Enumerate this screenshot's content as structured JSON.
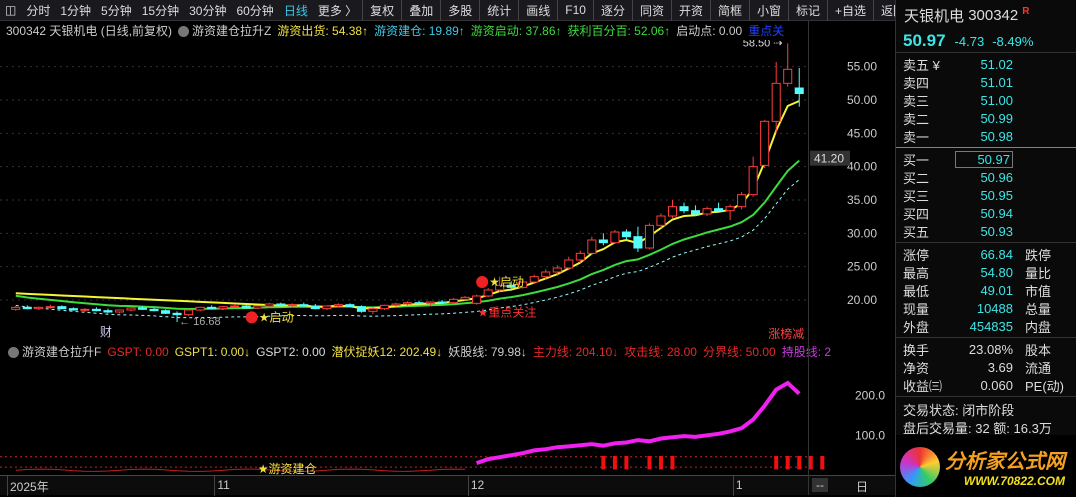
{
  "toolbar": {
    "period_items": [
      "分时",
      "1分钟",
      "5分钟",
      "15分钟",
      "30分钟",
      "60分钟",
      "日线",
      "更多 〉"
    ],
    "active": "日线",
    "buttons": [
      "复权",
      "叠加",
      "多股",
      "统计",
      "画线",
      "F10",
      "逐分",
      "同资",
      "开资",
      "简框",
      "小窗",
      "标记",
      "+自选",
      "返回"
    ]
  },
  "infobar": {
    "title": "300342 天银机电 (日线,前复权)",
    "indicator": "游资建仓拉升Z",
    "items": [
      {
        "label": "游资出货: 54.38↑",
        "color": "#f0e040"
      },
      {
        "label": "游资建仓: 19.89↑",
        "color": "#3cc8e6"
      },
      {
        "label": "游资启动: 37.86↑",
        "color": "#3cdc3c"
      },
      {
        "label": "获利百分百: 52.06↑",
        "color": "#3cdc3c"
      },
      {
        "label": "启动点: 0.00",
        "color": "#ccc"
      },
      {
        "label": "重点关",
        "color": "#2040ff"
      }
    ]
  },
  "chart_data": {
    "type": "candlestick",
    "price_ticks": [
      55,
      50,
      45,
      40,
      35,
      30,
      25,
      20
    ],
    "ylim": [
      14,
      59
    ],
    "current_marker": "41.20",
    "high_label": "58.50",
    "low_label": "16.68",
    "ohlc": [
      [
        18.6,
        19.1,
        18.4,
        18.9
      ],
      [
        18.9,
        19.2,
        18.6,
        18.7
      ],
      [
        18.7,
        19.0,
        18.5,
        18.9
      ],
      [
        18.9,
        19.3,
        18.7,
        19.0
      ],
      [
        19.0,
        19.2,
        18.6,
        18.7
      ],
      [
        18.7,
        18.9,
        18.4,
        18.5
      ],
      [
        18.5,
        18.8,
        18.2,
        18.6
      ],
      [
        18.6,
        18.9,
        18.3,
        18.4
      ],
      [
        18.4,
        18.7,
        18.0,
        18.2
      ],
      [
        18.2,
        18.6,
        18.0,
        18.5
      ],
      [
        18.5,
        18.9,
        18.3,
        18.8
      ],
      [
        18.8,
        19.1,
        18.5,
        18.6
      ],
      [
        18.6,
        18.8,
        18.3,
        18.4
      ],
      [
        18.4,
        18.6,
        17.9,
        18.0
      ],
      [
        18.0,
        18.3,
        16.7,
        17.8
      ],
      [
        17.8,
        18.6,
        17.6,
        18.5
      ],
      [
        18.5,
        19.0,
        18.3,
        18.9
      ],
      [
        18.9,
        19.2,
        18.6,
        18.7
      ],
      [
        18.7,
        19.1,
        18.5,
        19.0
      ],
      [
        19.0,
        19.4,
        18.8,
        19.1
      ],
      [
        19.1,
        19.3,
        18.7,
        18.8
      ],
      [
        18.8,
        19.2,
        18.6,
        19.1
      ],
      [
        19.1,
        19.6,
        18.9,
        19.4
      ],
      [
        19.4,
        19.6,
        19.0,
        19.2
      ],
      [
        19.2,
        19.5,
        18.9,
        19.3
      ],
      [
        19.3,
        19.6,
        19.0,
        19.1
      ],
      [
        19.1,
        19.4,
        18.6,
        18.7
      ],
      [
        18.7,
        19.2,
        18.5,
        19.1
      ],
      [
        19.1,
        19.5,
        18.9,
        19.3
      ],
      [
        19.3,
        19.5,
        18.9,
        19.0
      ],
      [
        19.0,
        19.2,
        18.1,
        18.3
      ],
      [
        18.3,
        18.9,
        17.9,
        18.7
      ],
      [
        18.7,
        19.3,
        18.5,
        19.2
      ],
      [
        19.2,
        19.6,
        19.0,
        19.4
      ],
      [
        19.4,
        19.8,
        19.2,
        19.6
      ],
      [
        19.6,
        19.9,
        19.3,
        19.5
      ],
      [
        19.5,
        19.8,
        19.1,
        19.7
      ],
      [
        19.7,
        20.0,
        19.4,
        19.6
      ],
      [
        19.6,
        20.3,
        19.5,
        20.1
      ],
      [
        20.1,
        20.6,
        19.9,
        20.4
      ],
      [
        19.5,
        20.8,
        19.3,
        20.6
      ],
      [
        20.6,
        21.8,
        20.4,
        21.5
      ],
      [
        21.5,
        23.5,
        21.2,
        22.2
      ],
      [
        22.2,
        22.8,
        21.4,
        21.9
      ],
      [
        21.9,
        23.0,
        21.7,
        22.7
      ],
      [
        22.7,
        23.8,
        22.4,
        23.5
      ],
      [
        23.5,
        24.6,
        23.0,
        24.2
      ],
      [
        24.2,
        25.2,
        23.6,
        24.8
      ],
      [
        24.8,
        26.5,
        24.5,
        26.0
      ],
      [
        26.0,
        27.4,
        25.6,
        27.0
      ],
      [
        27.0,
        29.5,
        26.8,
        29.0
      ],
      [
        29.0,
        30.0,
        28.2,
        28.6
      ],
      [
        28.6,
        30.5,
        28.4,
        30.2
      ],
      [
        30.2,
        30.6,
        29.0,
        29.5
      ],
      [
        29.5,
        31.0,
        27.2,
        27.8
      ],
      [
        27.8,
        31.5,
        27.6,
        31.2
      ],
      [
        31.2,
        33.0,
        30.8,
        32.6
      ],
      [
        32.6,
        35.0,
        32.3,
        34.0
      ],
      [
        34.0,
        34.6,
        33.0,
        33.4
      ],
      [
        33.4,
        34.2,
        32.6,
        32.9
      ],
      [
        32.9,
        34.0,
        32.6,
        33.7
      ],
      [
        33.7,
        34.6,
        33.2,
        33.4
      ],
      [
        33.4,
        34.3,
        32.0,
        34.0
      ],
      [
        34.0,
        36.2,
        33.6,
        35.8
      ],
      [
        35.8,
        41.5,
        35.5,
        40.0
      ],
      [
        40.2,
        47.0,
        39.8,
        46.8
      ],
      [
        46.8,
        55.7,
        45.0,
        52.5
      ],
      [
        52.5,
        58.5,
        52.0,
        54.6
      ],
      [
        51.8,
        54.8,
        49.0,
        50.97
      ]
    ],
    "annotations": [
      {
        "text": "★启动",
        "index": 21,
        "color": "#f0e040"
      },
      {
        "text": "★启动",
        "index": 41,
        "color": "#f0e040"
      },
      {
        "text": "★重点关注",
        "index": 40,
        "color": "#ff3030"
      },
      {
        "text": "财",
        "index": 8,
        "color": "#cce"
      },
      {
        "text": "涨榜减",
        "index": 66,
        "color": "#f44"
      }
    ],
    "date_labels": [
      {
        "text": "2025年",
        "index": 0
      },
      {
        "text": "11",
        "index": 18
      },
      {
        "text": "12",
        "index": 40
      },
      {
        "text": "1",
        "index": 63
      }
    ],
    "lower": {
      "ticks": [
        200,
        100
      ],
      "ylim": [
        0,
        290
      ],
      "line_start": 40,
      "line": [
        30,
        40,
        45,
        50,
        55,
        62,
        65,
        70,
        72,
        75,
        78,
        74,
        80,
        82,
        88,
        85,
        92,
        95,
        98,
        96,
        100,
        104,
        110,
        118,
        140,
        175,
        215,
        232,
        205
      ],
      "bars": [
        51,
        52,
        53,
        55,
        56,
        57,
        66,
        67,
        68,
        69,
        70
      ]
    }
  },
  "ind_header": {
    "name": "游资建仓拉升F",
    "items": [
      {
        "label": "GSPT: 0.00",
        "color": "#e62828"
      },
      {
        "label": "GSPT1: 0.00↓",
        "color": "#f0e040"
      },
      {
        "label": "GSPT2: 0.00",
        "color": "#ddd"
      },
      {
        "label": "潜伏捉妖12: 202.49↓",
        "color": "#f0e040"
      },
      {
        "label": "妖股线: 79.98↓",
        "color": "#ccc"
      },
      {
        "label": "主力线: 204.10↓",
        "color": "#e62828"
      },
      {
        "label": "攻击线: 28.00",
        "color": "#e62828"
      },
      {
        "label": "分界线: 50.00",
        "color": "#e62828"
      },
      {
        "label": "持股线: 2",
        "color": "#c83cdc"
      }
    ],
    "lower_label": "★游资建仓"
  },
  "dates_extra": {
    "dash": "--",
    "day": "日"
  },
  "panel": {
    "name": "天银机电",
    "code": "300342",
    "r": "R",
    "price": "50.97",
    "change": "-4.73",
    "pct": "-8.49%",
    "sells": [
      [
        "卖五 ¥",
        "51.02"
      ],
      [
        "卖四",
        "51.01"
      ],
      [
        "卖三",
        "51.00"
      ],
      [
        "卖二",
        "50.99"
      ],
      [
        "卖一",
        "50.98"
      ]
    ],
    "buys": [
      [
        "买一",
        "50.97"
      ],
      [
        "买二",
        "50.96"
      ],
      [
        "买三",
        "50.95"
      ],
      [
        "买四",
        "50.94"
      ],
      [
        "买五",
        "50.93"
      ]
    ],
    "stats": [
      [
        "涨停",
        "66.84",
        "跌停",
        "rd"
      ],
      [
        "最高",
        "54.80",
        "量比",
        "cy"
      ],
      [
        "最低",
        "49.01",
        "市值",
        "cy"
      ],
      [
        "现量",
        "10488",
        "总量",
        "pu"
      ],
      [
        "外盘",
        "454835",
        "内盘",
        "rd"
      ]
    ],
    "stats2": [
      [
        "换手",
        "23.08%",
        "股本"
      ],
      [
        "净资",
        "3.69",
        "流通"
      ],
      [
        "收益㈢",
        "0.060",
        "PE(动)"
      ]
    ],
    "status": "交易状态: 闭市阶段",
    "after": "盘后交易量: 32  额: 16.3万",
    "logo1": "分析家公式网",
    "logo2": "WWW.70822.COM"
  }
}
